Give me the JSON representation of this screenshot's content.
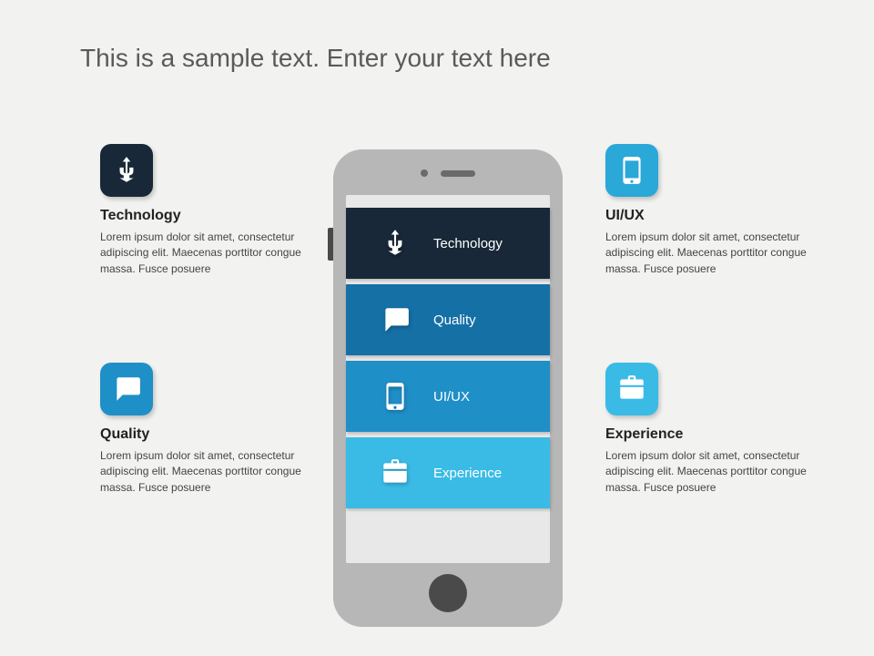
{
  "title": "This is a sample text. Enter your text here",
  "features": {
    "technology": {
      "title": "Technology",
      "desc": "Lorem ipsum dolor sit amet, consectetur adipiscing elit. Maecenas porttitor congue massa. Fusce posuere",
      "color": "#182838"
    },
    "quality": {
      "title": "Quality",
      "desc": "Lorem ipsum dolor sit amet, consectetur adipiscing elit. Maecenas porttitor congue massa. Fusce posuere",
      "color": "#1f8fc7"
    },
    "uiux": {
      "title": "UI/UX",
      "desc": "Lorem ipsum dolor sit amet, consectetur adipiscing elit. Maecenas porttitor congue massa. Fusce posuere",
      "color": "#2aa8d8"
    },
    "experience": {
      "title": "Experience",
      "desc": "Lorem ipsum dolor sit amet, consectetur adipiscing elit. Maecenas porttitor congue massa. Fusce posuere",
      "color": "#3abbe6"
    }
  },
  "phone_tiles": [
    {
      "label": "Technology",
      "icon": "usb-icon",
      "color_class": "c-dark"
    },
    {
      "label": "Quality",
      "icon": "chat-star-icon",
      "color_class": "c-b1"
    },
    {
      "label": "UI/UX",
      "icon": "smartphone-icon",
      "color_class": "c-b2"
    },
    {
      "label": "Experience",
      "icon": "briefcase-icon",
      "color_class": "c-b4"
    }
  ]
}
